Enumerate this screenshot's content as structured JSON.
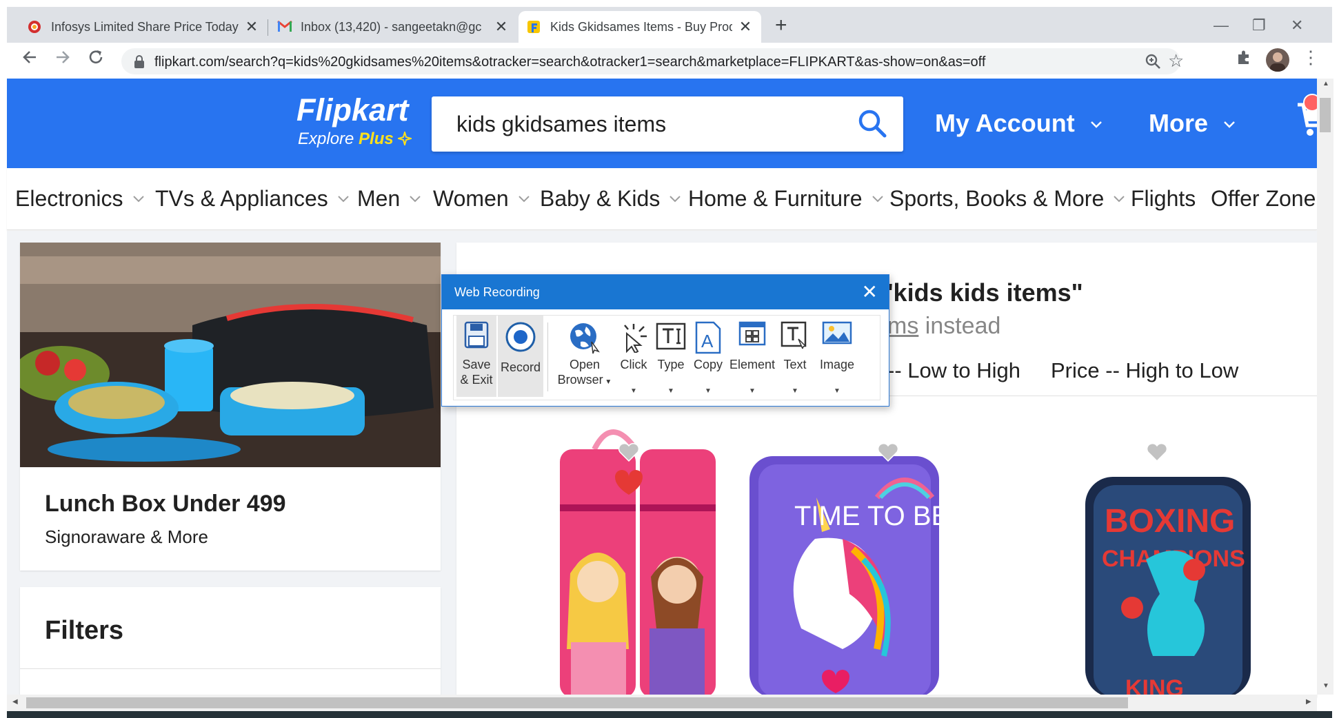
{
  "browser": {
    "tabs": [
      {
        "title": "Infosys Limited Share Price Today",
        "favicon": "opera-red-icon"
      },
      {
        "title": "Inbox (13,420) - sangeetakn@gc",
        "favicon": "gmail-icon"
      },
      {
        "title": "Kids Gkidsames Items - Buy Prod",
        "favicon": "flipkart-icon",
        "active": true
      }
    ],
    "new_tab": "+",
    "url": "flipkart.com/search?q=kids%20gkidsames%20items&otracker=search&otracker1=search&marketplace=FLIPKART&as-show=on&as=off"
  },
  "header": {
    "brand": "Flipkart",
    "brand_sub_prefix": "Explore ",
    "brand_sub_plus": "Plus",
    "search_value": "kids gkidsames items",
    "my_account": "My Account",
    "more": "More",
    "accent": "#2874f0",
    "plus_color": "#ffe11b"
  },
  "categories": [
    {
      "label": "Electronics",
      "dropdown": true
    },
    {
      "label": "TVs & Appliances",
      "dropdown": true
    },
    {
      "label": "Men",
      "dropdown": true
    },
    {
      "label": "Women",
      "dropdown": true
    },
    {
      "label": "Baby & Kids",
      "dropdown": true
    },
    {
      "label": "Home & Furniture",
      "dropdown": true
    },
    {
      "label": "Sports, Books & More",
      "dropdown": true
    },
    {
      "label": "Flights",
      "dropdown": false
    },
    {
      "label": "Offer Zone",
      "dropdown": false
    }
  ],
  "promo": {
    "title": "Lunch Box Under 499",
    "subtitle": "Signoraware & More"
  },
  "filters": {
    "title": "Filters"
  },
  "results": {
    "title_fragment": "'kids kids items\"",
    "instead_link_fragment": "ms",
    "instead_text": " instead",
    "sort_low_high_fragment": "-- Low to High",
    "sort_high_low": "Price -- High to Low"
  },
  "products": [
    {
      "name": "pencil-case-princess"
    },
    {
      "name": "pencil-case-unicorn",
      "print": "TIME TO BE"
    },
    {
      "name": "pencil-case-boxing",
      "print1": "BOXING",
      "print2": "CHAMPIONS",
      "print3": "KING"
    }
  ],
  "recorder": {
    "title": "Web Recording",
    "tools": [
      {
        "id": "save-exit",
        "label1": "Save",
        "label2": "& Exit"
      },
      {
        "id": "record",
        "label1": "Record"
      },
      {
        "id": "open-browser",
        "label1": "Open",
        "label2": "Browser",
        "dropdown": true
      },
      {
        "id": "click",
        "label1": "Click",
        "dropdown": true
      },
      {
        "id": "type",
        "label1": "Type",
        "dropdown": true
      },
      {
        "id": "copy",
        "label1": "Copy",
        "dropdown": true
      },
      {
        "id": "element",
        "label1": "Element",
        "dropdown": true
      },
      {
        "id": "text",
        "label1": "Text",
        "dropdown": true
      },
      {
        "id": "image",
        "label1": "Image",
        "dropdown": true
      }
    ]
  }
}
